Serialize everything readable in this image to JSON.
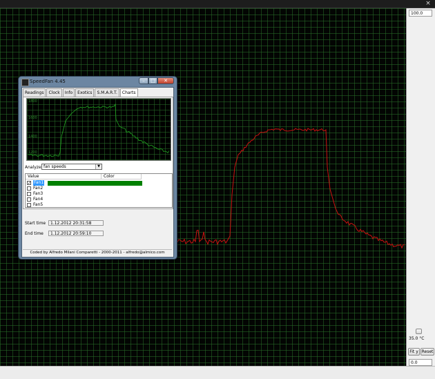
{
  "topbar": {
    "close_glyph": "×"
  },
  "main_plot": {
    "line_color": "#cc1111",
    "grid_color": "#2a6e2a"
  },
  "right_panel": {
    "ymax": "100.0",
    "temp_value": "35.0 °C",
    "fit_y_label": "Fit y",
    "reset_label": "Reset",
    "ymin": "0.0"
  },
  "window": {
    "title": "SpeedFan 4.45",
    "minimize_glyph": "–",
    "maximize_glyph": "□",
    "close_glyph": "✕",
    "tabs": [
      {
        "label": "Readings"
      },
      {
        "label": "Clock"
      },
      {
        "label": "Info"
      },
      {
        "label": "Exotics"
      },
      {
        "label": "S.M.A.R.T."
      },
      {
        "label": "Charts"
      }
    ],
    "chart": {
      "y_ticks": [
        "1800",
        "1600",
        "1400",
        "1200"
      ],
      "line_color": "#22aa22"
    },
    "analyze_label": "Analyze",
    "analyze_value": "fan speeds",
    "list": {
      "col_value": "Value",
      "col_color": "Color",
      "fans": [
        {
          "name": "Fan1",
          "checked": true,
          "color": "#008000"
        },
        {
          "name": "Fan2",
          "checked": false
        },
        {
          "name": "Fan3",
          "checked": false
        },
        {
          "name": "Fan4",
          "checked": false
        },
        {
          "name": "Fan5",
          "checked": false
        }
      ]
    },
    "start_time_label": "Start time",
    "start_time_value": "1.12.2012 20:31:58",
    "end_time_label": "End time",
    "end_time_value": "1.12.2012 20:59:10",
    "status": "Coded by Alfredo Milani Comparetti - 2000-2011 - alfredo@almico.com"
  }
}
